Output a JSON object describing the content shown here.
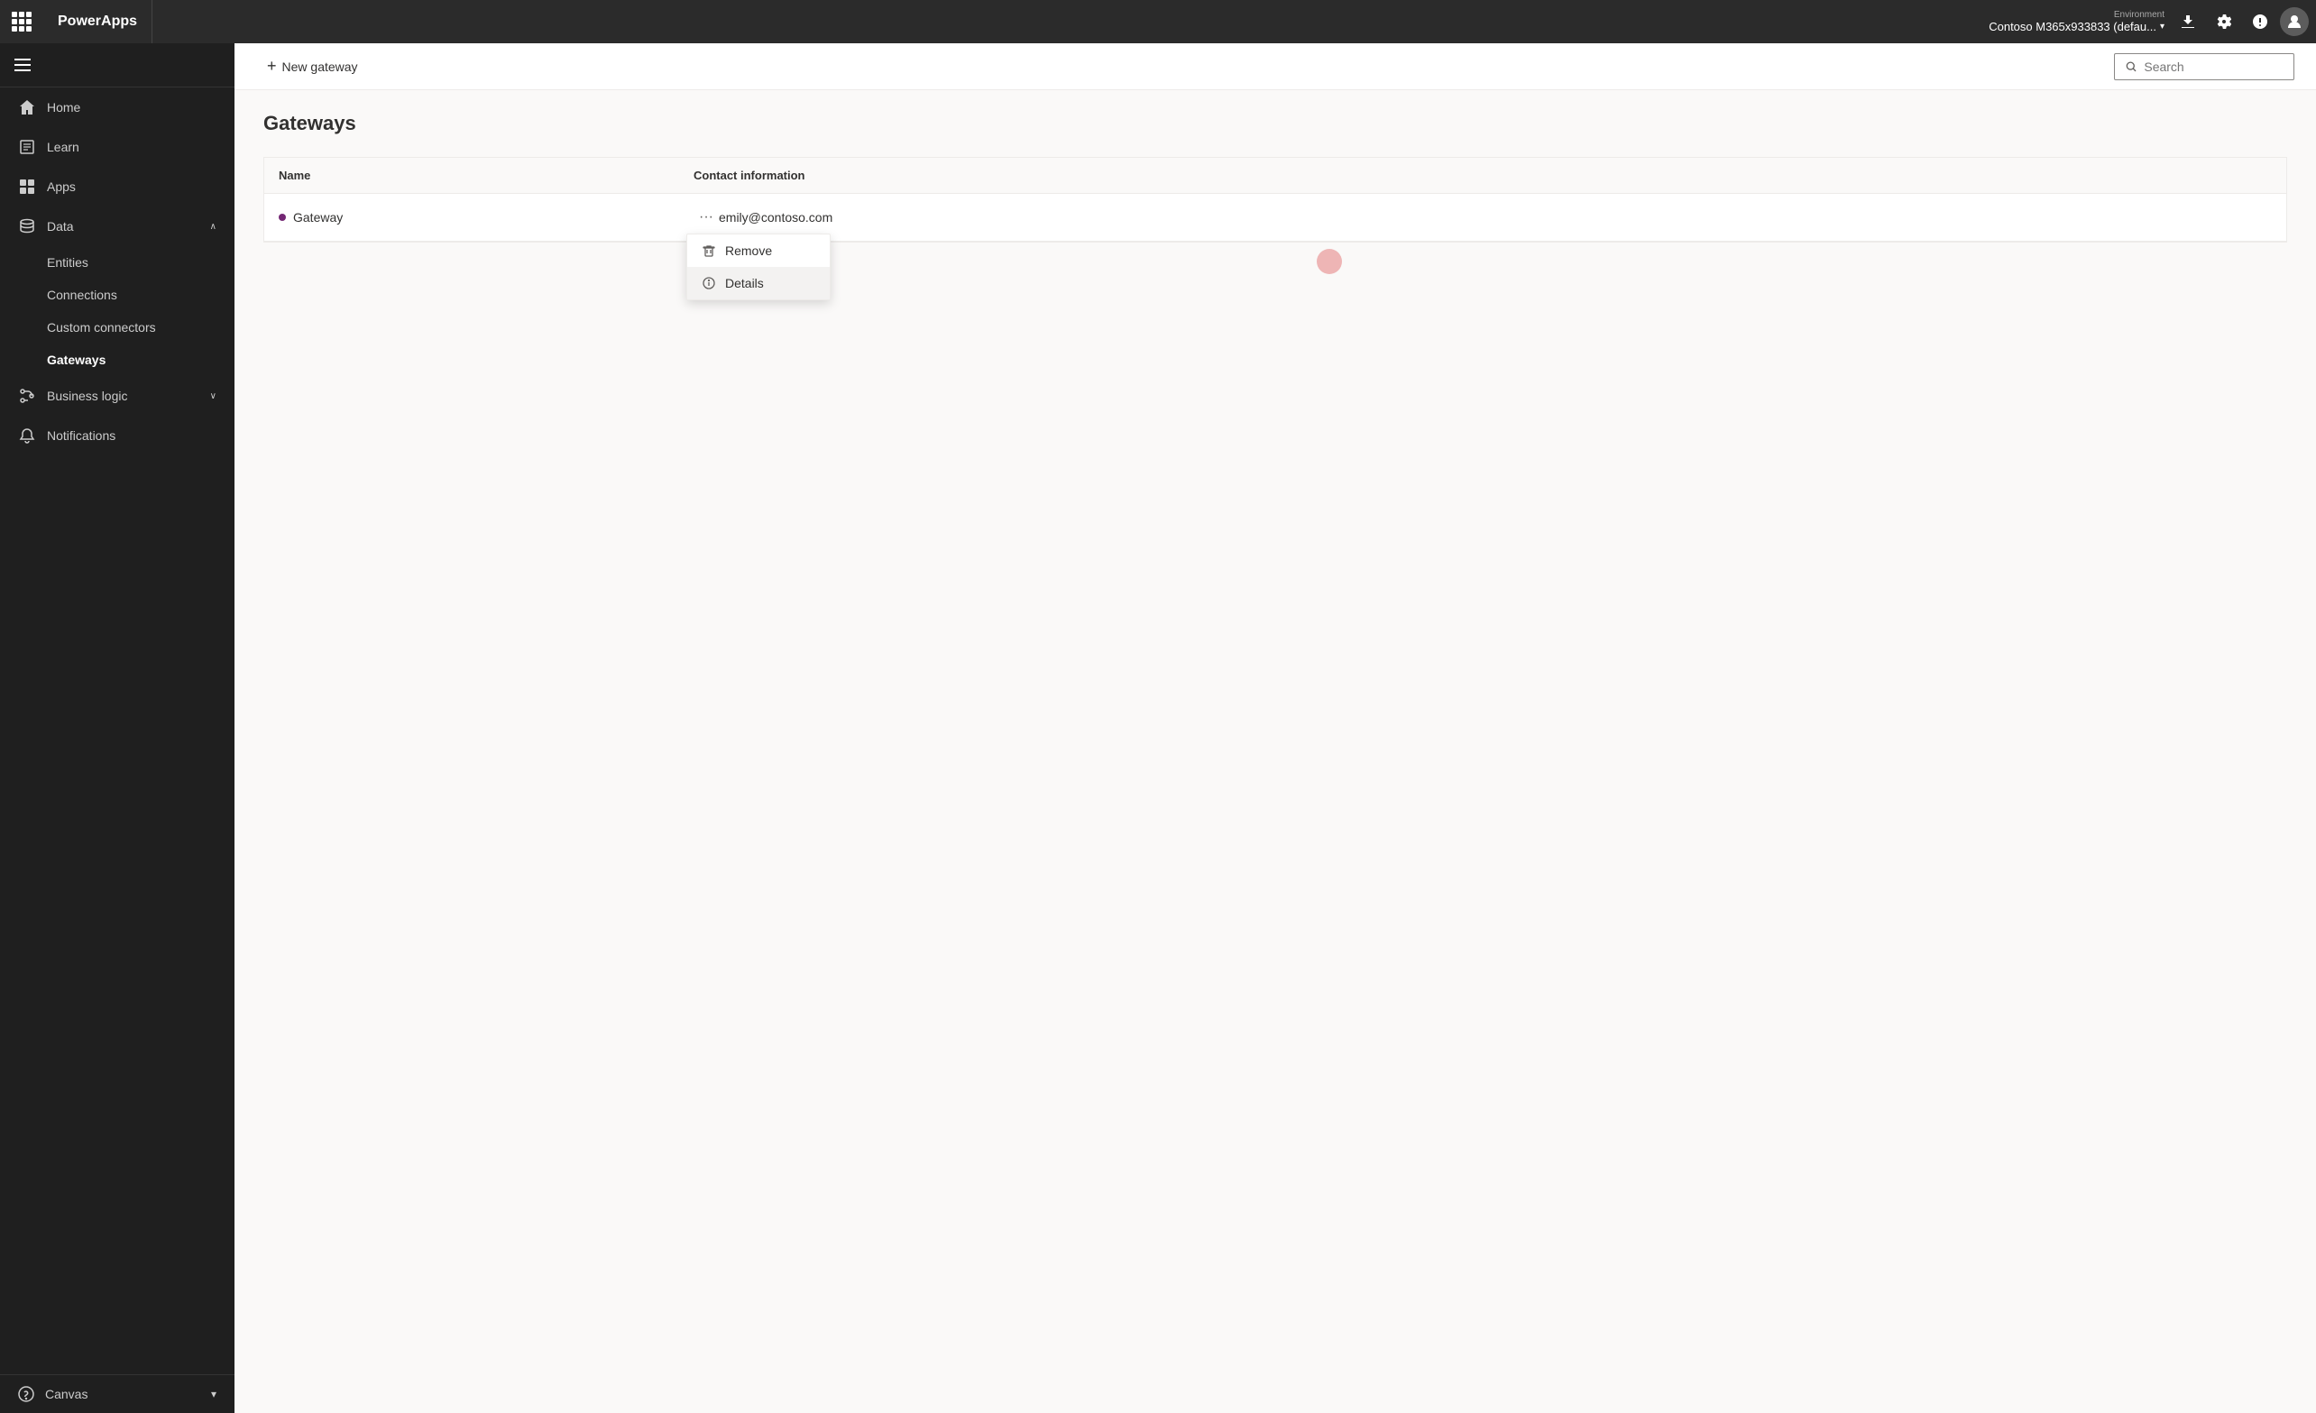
{
  "header": {
    "app_title": "PowerApps",
    "env_label": "Environment",
    "env_name": "Contoso M365x933833 (defau...",
    "download_icon": "⬇",
    "settings_icon": "⚙",
    "help_icon": "?",
    "search_placeholder": "Search"
  },
  "sidebar": {
    "hamburger_label": "Menu",
    "items": [
      {
        "id": "home",
        "label": "Home",
        "icon": "home"
      },
      {
        "id": "learn",
        "label": "Learn",
        "icon": "book"
      },
      {
        "id": "apps",
        "label": "Apps",
        "icon": "apps"
      },
      {
        "id": "data",
        "label": "Data",
        "icon": "data",
        "expanded": true,
        "sub_items": [
          {
            "id": "entities",
            "label": "Entities"
          },
          {
            "id": "connections",
            "label": "Connections"
          },
          {
            "id": "custom-connectors",
            "label": "Custom connectors"
          },
          {
            "id": "gateways",
            "label": "Gateways",
            "active": true
          }
        ]
      },
      {
        "id": "business-logic",
        "label": "Business logic",
        "icon": "logic",
        "expandable": true
      },
      {
        "id": "notifications",
        "label": "Notifications",
        "icon": "bell"
      }
    ],
    "bottom": {
      "item_label": "Canvas",
      "chevron": "▾"
    }
  },
  "toolbar": {
    "new_gateway_label": "New gateway",
    "new_gateway_icon": "+"
  },
  "page": {
    "title": "Gateways",
    "table": {
      "headers": [
        {
          "id": "name",
          "label": "Name"
        },
        {
          "id": "contact",
          "label": "Contact information"
        }
      ],
      "rows": [
        {
          "id": "gateway-1",
          "name": "Gateway",
          "contact": "emily@contoso.com"
        }
      ]
    }
  },
  "context_menu": {
    "items": [
      {
        "id": "remove",
        "label": "Remove",
        "icon": "trash"
      },
      {
        "id": "details",
        "label": "Details",
        "icon": "info"
      }
    ]
  }
}
